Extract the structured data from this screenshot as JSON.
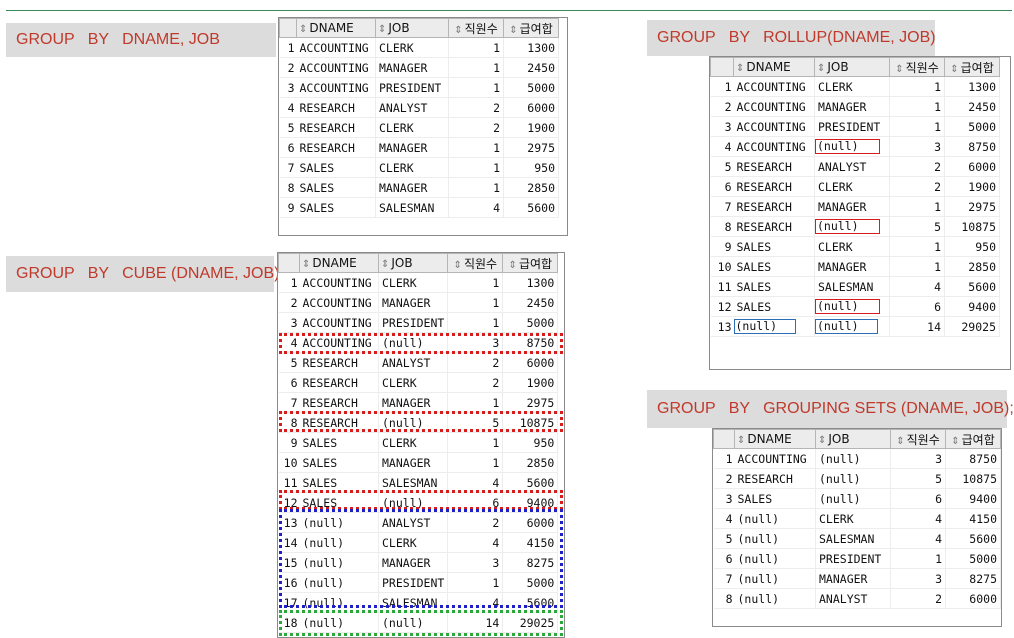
{
  "labels": {
    "group_by": "GROUP   BY   DNAME, JOB",
    "cube": "GROUP   BY   CUBE (DNAME, JOB)",
    "rollup": "GROUP   BY   ROLLUP(DNAME, JOB)",
    "grouping_sets": "GROUP   BY   GROUPING SETS (DNAME, JOB);"
  },
  "columns": [
    "DNAME",
    "JOB",
    "직원수",
    "급여합"
  ],
  "tables": {
    "group_by": {
      "rows": [
        [
          "1",
          "ACCOUNTING",
          "CLERK",
          "1",
          "1300"
        ],
        [
          "2",
          "ACCOUNTING",
          "MANAGER",
          "1",
          "2450"
        ],
        [
          "3",
          "ACCOUNTING",
          "PRESIDENT",
          "1",
          "5000"
        ],
        [
          "4",
          "RESEARCH",
          "ANALYST",
          "2",
          "6000"
        ],
        [
          "5",
          "RESEARCH",
          "CLERK",
          "2",
          "1900"
        ],
        [
          "6",
          "RESEARCH",
          "MANAGER",
          "1",
          "2975"
        ],
        [
          "7",
          "SALES",
          "CLERK",
          "1",
          "950"
        ],
        [
          "8",
          "SALES",
          "MANAGER",
          "1",
          "2850"
        ],
        [
          "9",
          "SALES",
          "SALESMAN",
          "4",
          "5600"
        ]
      ]
    },
    "cube": {
      "rows": [
        [
          "1",
          "ACCOUNTING",
          "CLERK",
          "1",
          "1300"
        ],
        [
          "2",
          "ACCOUNTING",
          "MANAGER",
          "1",
          "2450"
        ],
        [
          "3",
          "ACCOUNTING",
          "PRESIDENT",
          "1",
          "5000"
        ],
        [
          "4",
          "ACCOUNTING",
          "(null)",
          "3",
          "8750"
        ],
        [
          "5",
          "RESEARCH",
          "ANALYST",
          "2",
          "6000"
        ],
        [
          "6",
          "RESEARCH",
          "CLERK",
          "2",
          "1900"
        ],
        [
          "7",
          "RESEARCH",
          "MANAGER",
          "1",
          "2975"
        ],
        [
          "8",
          "RESEARCH",
          "(null)",
          "5",
          "10875"
        ],
        [
          "9",
          "SALES",
          "CLERK",
          "1",
          "950"
        ],
        [
          "10",
          "SALES",
          "MANAGER",
          "1",
          "2850"
        ],
        [
          "11",
          "SALES",
          "SALESMAN",
          "4",
          "5600"
        ],
        [
          "12",
          "SALES",
          "(null)",
          "6",
          "9400"
        ],
        [
          "13",
          "(null)",
          "ANALYST",
          "2",
          "6000"
        ],
        [
          "14",
          "(null)",
          "CLERK",
          "4",
          "4150"
        ],
        [
          "15",
          "(null)",
          "MANAGER",
          "3",
          "8275"
        ],
        [
          "16",
          "(null)",
          "PRESIDENT",
          "1",
          "5000"
        ],
        [
          "17",
          "(null)",
          "SALESMAN",
          "4",
          "5600"
        ],
        [
          "18",
          "(null)",
          "(null)",
          "14",
          "29025"
        ]
      ]
    },
    "rollup": {
      "rows": [
        [
          "1",
          "ACCOUNTING",
          "CLERK",
          "1",
          "1300"
        ],
        [
          "2",
          "ACCOUNTING",
          "MANAGER",
          "1",
          "2450"
        ],
        [
          "3",
          "ACCOUNTING",
          "PRESIDENT",
          "1",
          "5000"
        ],
        [
          "4",
          "ACCOUNTING",
          "(null)",
          "3",
          "8750"
        ],
        [
          "5",
          "RESEARCH",
          "ANALYST",
          "2",
          "6000"
        ],
        [
          "6",
          "RESEARCH",
          "CLERK",
          "2",
          "1900"
        ],
        [
          "7",
          "RESEARCH",
          "MANAGER",
          "1",
          "2975"
        ],
        [
          "8",
          "RESEARCH",
          "(null)",
          "5",
          "10875"
        ],
        [
          "9",
          "SALES",
          "CLERK",
          "1",
          "950"
        ],
        [
          "10",
          "SALES",
          "MANAGER",
          "1",
          "2850"
        ],
        [
          "11",
          "SALES",
          "SALESMAN",
          "4",
          "5600"
        ],
        [
          "12",
          "SALES",
          "(null)",
          "6",
          "9400"
        ],
        [
          "13",
          "(null)",
          "(null)",
          "14",
          "29025"
        ]
      ]
    },
    "grouping_sets": {
      "rows": [
        [
          "1",
          "ACCOUNTING",
          "(null)",
          "3",
          "8750"
        ],
        [
          "2",
          "RESEARCH",
          "(null)",
          "5",
          "10875"
        ],
        [
          "3",
          "SALES",
          "(null)",
          "6",
          "9400"
        ],
        [
          "4",
          "(null)",
          "CLERK",
          "4",
          "4150"
        ],
        [
          "5",
          "(null)",
          "SALESMAN",
          "4",
          "5600"
        ],
        [
          "6",
          "(null)",
          "PRESIDENT",
          "1",
          "5000"
        ],
        [
          "7",
          "(null)",
          "MANAGER",
          "3",
          "8275"
        ],
        [
          "8",
          "(null)",
          "ANALYST",
          "2",
          "6000"
        ]
      ]
    }
  },
  "colors": {
    "label_text": "#c0392b",
    "label_bg": "#dcdcdc",
    "highlight_red": "#d81b1b",
    "highlight_blue": "#1f1fc8",
    "highlight_green": "#2aa83a",
    "rollup_total_box": "#2a6fb5"
  }
}
